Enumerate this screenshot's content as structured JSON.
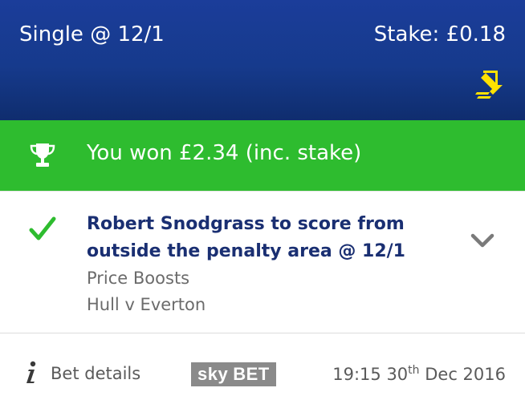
{
  "header": {
    "bet_type": "Single @ 12/1",
    "stake": "Stake: £0.18",
    "cashout_icon": "up-arrow-icon",
    "arrow_color": "#ffe100",
    "background": "#163a8c"
  },
  "result": {
    "icon": "trophy-icon",
    "text": "You won £2.34 (inc. stake)",
    "background": "#2ebc2f"
  },
  "selection": {
    "status_icon": "checkmark-icon",
    "title": "Robert Snodgrass to score from outside the penalty area @ 12/1",
    "market": "Price Boosts",
    "event": "Hull v Everton",
    "expand_icon": "chevron-down-icon",
    "title_color": "#1a2f72"
  },
  "footer": {
    "info_icon": "info-icon",
    "bet_details_label": "Bet details",
    "logo": {
      "part1": "sky",
      "part2": "BET"
    },
    "time": "19:15",
    "day": "30",
    "ordinal": "th",
    "month_year": "Dec 2016"
  }
}
